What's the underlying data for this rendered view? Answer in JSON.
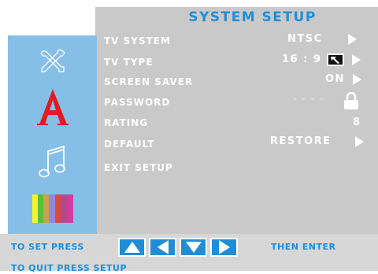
{
  "title": "SYSTEM SETUP",
  "colors": {
    "accent": "#1f8ed8",
    "panel": "#c9c9c9",
    "sidebar": "#85bfe8",
    "footer": "#d7d7d7",
    "text": "#ffffff"
  },
  "sidebar_icons": [
    "tools-icon",
    "font-a-icon",
    "music-note-icon",
    "color-bars-icon"
  ],
  "menu": {
    "tv_system": {
      "label": "TV SYSTEM",
      "value": "NTSC"
    },
    "tv_type": {
      "label": "TV TYPE",
      "value": "16 : 9"
    },
    "screen_saver": {
      "label": "SCREEN SAVER",
      "value": "ON"
    },
    "password": {
      "label": "PASSWORD",
      "value": "- - - -"
    },
    "rating": {
      "label": "RATING",
      "value": "8"
    },
    "default": {
      "label": "DEFAULT",
      "value": "RESTORE"
    },
    "exit": {
      "label": "EXIT SETUP"
    }
  },
  "footer": {
    "set_text": "TO SET PRESS",
    "then_text": "THEN ENTER",
    "quit_text": "TO QUIT PRESS SETUP",
    "nav_buttons": [
      "up-arrow-icon",
      "left-arrow-icon",
      "down-arrow-icon",
      "right-arrow-icon"
    ]
  }
}
